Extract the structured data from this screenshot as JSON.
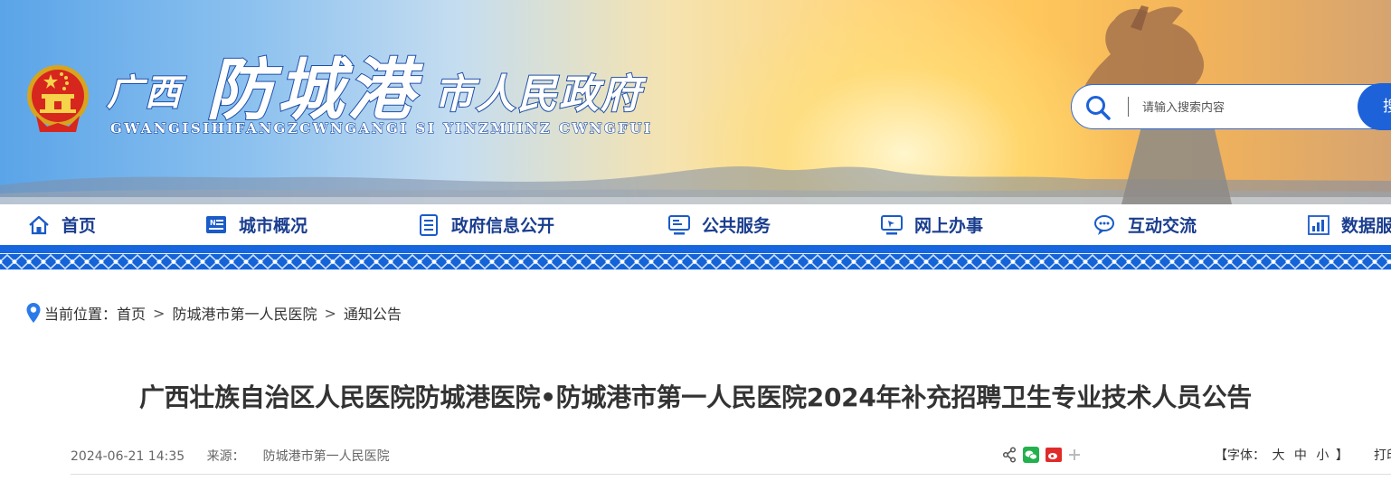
{
  "header": {
    "site_name_province": "广西",
    "site_name_city": "防城港",
    "site_name_suffix": "市人民政府",
    "site_name_pinyin": "GWANGISIHIFANGZCWNGANGI SI YINZMIINZ CWNGFUI"
  },
  "search": {
    "placeholder": "请输入搜索内容",
    "button_label": "搜索"
  },
  "nav": {
    "items": [
      {
        "label": "首页",
        "icon": "home-icon"
      },
      {
        "label": "城市概况",
        "icon": "city-overview-icon"
      },
      {
        "label": "政府信息公开",
        "icon": "document-list-icon"
      },
      {
        "label": "公共服务",
        "icon": "monitor-icon"
      },
      {
        "label": "网上办事",
        "icon": "online-service-icon"
      },
      {
        "label": "互动交流",
        "icon": "chat-icon"
      },
      {
        "label": "数据服务",
        "icon": "data-chart-icon"
      }
    ]
  },
  "breadcrumb": {
    "prefix": "当前位置：",
    "items": [
      "首页",
      "防城港市第一人民医院",
      "通知公告"
    ],
    "separator": ">"
  },
  "article": {
    "title": "广西壮族自治区人民医院防城港医院•防城港市第一人民医院2024年补充招聘卫生专业技术人员公告",
    "date": "2024-06-21 14:35",
    "source_label": "来源：",
    "source": "防城港市第一人民医院",
    "font_size_label": "【字体：",
    "font_size_options": [
      "大",
      "中",
      "小"
    ],
    "font_size_close": "】",
    "print_label": "打印"
  },
  "colors": {
    "nav_text": "#1a3d8f",
    "brand_blue": "#1d62d8",
    "nav_bar": "#1666e0"
  }
}
